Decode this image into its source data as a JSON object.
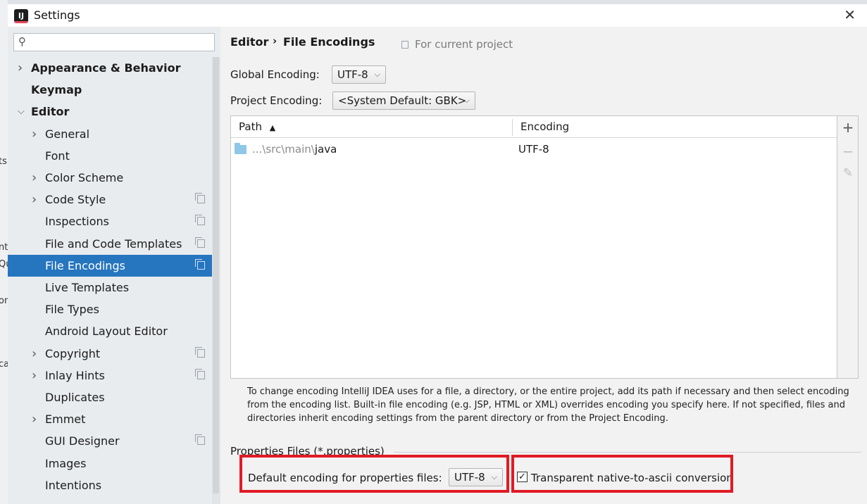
{
  "window": {
    "title": "Settings",
    "logo_text": "IJ"
  },
  "search": {
    "placeholder": ""
  },
  "sidebar": {
    "items": [
      {
        "label": "Appearance & Behavior",
        "level": 0,
        "chevron": "right",
        "bold": true,
        "copy_icon": false,
        "selected": false
      },
      {
        "label": "Keymap",
        "level": 0,
        "chevron": "",
        "bold": true,
        "copy_icon": false,
        "selected": false
      },
      {
        "label": "Editor",
        "level": 0,
        "chevron": "down",
        "bold": true,
        "copy_icon": false,
        "selected": false
      },
      {
        "label": "General",
        "level": 1,
        "chevron": "right",
        "bold": false,
        "copy_icon": false,
        "selected": false
      },
      {
        "label": "Font",
        "level": 1,
        "chevron": "",
        "bold": false,
        "copy_icon": false,
        "selected": false
      },
      {
        "label": "Color Scheme",
        "level": 1,
        "chevron": "right",
        "bold": false,
        "copy_icon": false,
        "selected": false
      },
      {
        "label": "Code Style",
        "level": 1,
        "chevron": "right",
        "bold": false,
        "copy_icon": true,
        "selected": false
      },
      {
        "label": "Inspections",
        "level": 1,
        "chevron": "",
        "bold": false,
        "copy_icon": true,
        "selected": false
      },
      {
        "label": "File and Code Templates",
        "level": 1,
        "chevron": "",
        "bold": false,
        "copy_icon": true,
        "selected": false
      },
      {
        "label": "File Encodings",
        "level": 1,
        "chevron": "",
        "bold": false,
        "copy_icon": true,
        "selected": true
      },
      {
        "label": "Live Templates",
        "level": 1,
        "chevron": "",
        "bold": false,
        "copy_icon": false,
        "selected": false
      },
      {
        "label": "File Types",
        "level": 1,
        "chevron": "",
        "bold": false,
        "copy_icon": false,
        "selected": false
      },
      {
        "label": "Android Layout Editor",
        "level": 1,
        "chevron": "",
        "bold": false,
        "copy_icon": false,
        "selected": false
      },
      {
        "label": "Copyright",
        "level": 1,
        "chevron": "right",
        "bold": false,
        "copy_icon": true,
        "selected": false
      },
      {
        "label": "Inlay Hints",
        "level": 1,
        "chevron": "right",
        "bold": false,
        "copy_icon": true,
        "selected": false
      },
      {
        "label": "Duplicates",
        "level": 1,
        "chevron": "",
        "bold": false,
        "copy_icon": false,
        "selected": false
      },
      {
        "label": "Emmet",
        "level": 1,
        "chevron": "right",
        "bold": false,
        "copy_icon": false,
        "selected": false
      },
      {
        "label": "GUI Designer",
        "level": 1,
        "chevron": "",
        "bold": false,
        "copy_icon": true,
        "selected": false
      },
      {
        "label": "Images",
        "level": 1,
        "chevron": "",
        "bold": false,
        "copy_icon": false,
        "selected": false
      },
      {
        "label": "Intentions",
        "level": 1,
        "chevron": "",
        "bold": false,
        "copy_icon": false,
        "selected": false
      }
    ]
  },
  "breadcrumb": {
    "parent": "Editor",
    "separator": "›",
    "current": "File Encodings",
    "scope": "For current project"
  },
  "global_encoding": {
    "label": "Global Encoding:",
    "value": "UTF-8"
  },
  "project_encoding": {
    "label": "Project Encoding:",
    "value": "<System Default: GBK>"
  },
  "table": {
    "columns": [
      "Path",
      "Encoding"
    ],
    "sort_indicator": "▲",
    "rows": [
      {
        "path_prefix": "...\\src\\main\\",
        "path_name": "java",
        "encoding": "UTF-8"
      }
    ]
  },
  "toolbar": {
    "add": "+",
    "remove": "−",
    "edit": "✎"
  },
  "help_text": "To change encoding IntelliJ IDEA uses for a file, a directory, or the entire project, add its path if necessary and then select encoding from the encoding list. Built-in file encoding (e.g. JSP, HTML or XML) overrides encoding you specify here. If not specified, files and directories inherit encoding settings from the parent directory or from the Project Encoding.",
  "properties": {
    "section_title": "Properties Files (*.properties)",
    "default_label": "Default encoding for properties files:",
    "default_value": "UTF-8",
    "transparent_label": "Transparent native-to-ascii conversion",
    "transparent_checked": true
  },
  "colors": {
    "selection": "#2675bf",
    "highlight": "#e01b24",
    "folder": "#8ec7e8"
  }
}
